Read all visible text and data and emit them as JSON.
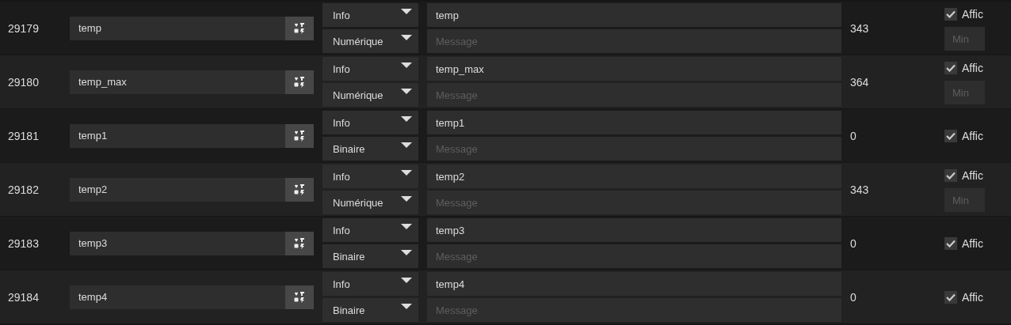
{
  "rows": [
    {
      "id": "29179",
      "name": "temp",
      "type": "Info",
      "subtype": "Numérique",
      "message_value": "temp",
      "message_placeholder": "Message",
      "value": "343",
      "display": {
        "label": "Affic",
        "checked": true
      },
      "min_placeholder": "Min"
    },
    {
      "id": "29180",
      "name": "temp_max",
      "type": "Info",
      "subtype": "Numérique",
      "message_value": "temp_max",
      "message_placeholder": "Message",
      "value": "364",
      "display": {
        "label": "Affic",
        "checked": true
      },
      "min_placeholder": "Min"
    },
    {
      "id": "29181",
      "name": "temp1",
      "type": "Info",
      "subtype": "Binaire",
      "message_value": "temp1",
      "message_placeholder": "Message",
      "value": "0",
      "display": {
        "label": "Affic",
        "checked": true
      }
    },
    {
      "id": "29182",
      "name": "temp2",
      "type": "Info",
      "subtype": "Numérique",
      "message_value": "temp2",
      "message_placeholder": "Message",
      "value": "343",
      "display": {
        "label": "Affic",
        "checked": true
      },
      "min_placeholder": "Min"
    },
    {
      "id": "29183",
      "name": "temp3",
      "type": "Info",
      "subtype": "Binaire",
      "message_value": "temp3",
      "message_placeholder": "Message",
      "value": "0",
      "display": {
        "label": "Affic",
        "checked": true
      }
    },
    {
      "id": "29184",
      "name": "temp4",
      "type": "Info",
      "subtype": "Binaire",
      "message_value": "temp4",
      "message_placeholder": "Message",
      "value": "0",
      "display": {
        "label": "Affic",
        "checked": true
      }
    }
  ]
}
